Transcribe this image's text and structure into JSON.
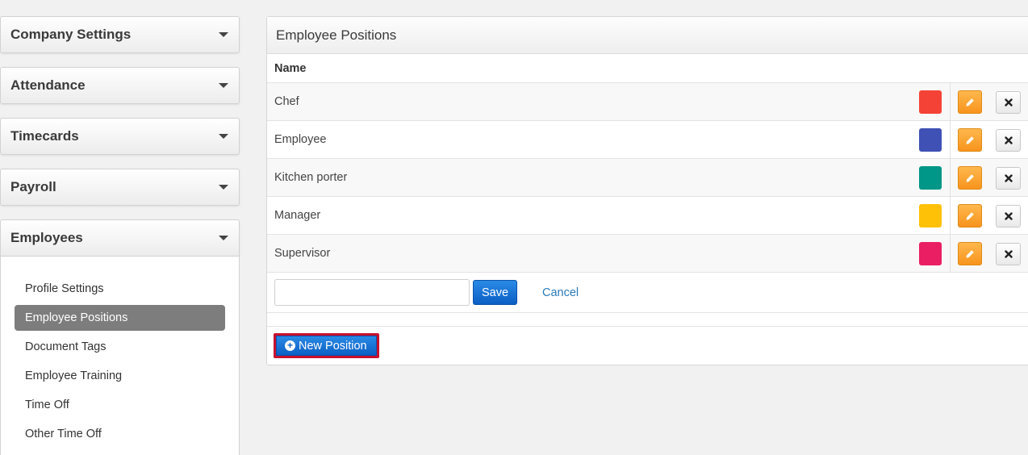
{
  "sidebar": {
    "sections": [
      {
        "label": "Company Settings"
      },
      {
        "label": "Attendance"
      },
      {
        "label": "Timecards"
      },
      {
        "label": "Payroll"
      },
      {
        "label": "Employees"
      }
    ],
    "employees_items": [
      {
        "label": "Profile Settings"
      },
      {
        "label": "Employee Positions"
      },
      {
        "label": "Document Tags"
      },
      {
        "label": "Employee Training"
      },
      {
        "label": "Time Off"
      },
      {
        "label": "Other Time Off"
      }
    ],
    "active_item": "Employee Positions"
  },
  "panel": {
    "title": "Employee Positions",
    "column_name": "Name",
    "positions": [
      {
        "name": "Chef",
        "color": "#f44336"
      },
      {
        "name": "Employee",
        "color": "#3f51b5"
      },
      {
        "name": "Kitchen porter",
        "color": "#009688"
      },
      {
        "name": "Manager",
        "color": "#ffc107"
      },
      {
        "name": "Supervisor",
        "color": "#e91e63"
      }
    ],
    "add_form": {
      "input_value": "",
      "save_label": "Save",
      "cancel_label": "Cancel"
    },
    "new_position_label": "New Position"
  },
  "colors": {
    "primary_blue": "#0b5fc4",
    "edit_orange": "#f7941d",
    "highlight_red": "#c8102e"
  }
}
